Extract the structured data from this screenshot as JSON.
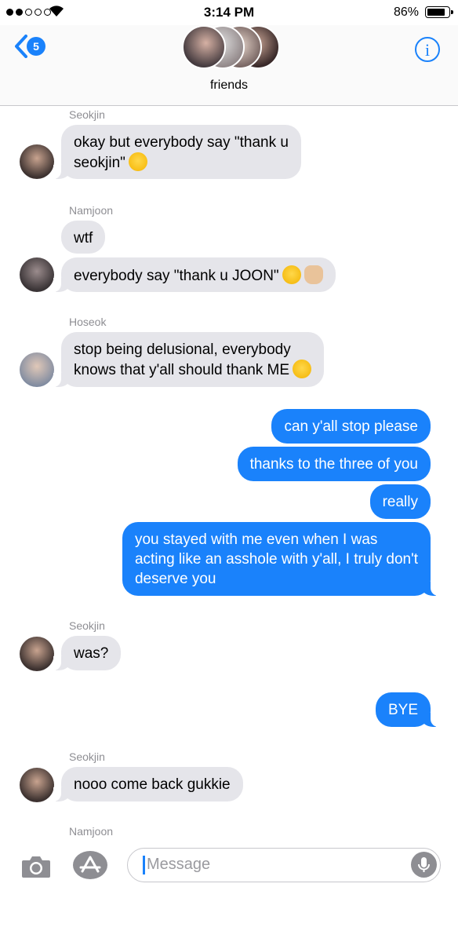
{
  "status_bar": {
    "time": "3:14 PM",
    "battery_percent": "86%",
    "signal_bars": 2,
    "battery_level": 0.86
  },
  "header": {
    "back_badge": "5",
    "group_name": "friends",
    "info_label": "i"
  },
  "chat": {
    "messages": [
      {
        "sender": "Seokjin",
        "lines": [
          "okay but everybody say \"thank u",
          "seokjin\""
        ],
        "emoji": "star-struck-emoji"
      },
      {
        "sender": "Namjoon",
        "lines": [
          "wtf"
        ]
      },
      {
        "sender": "Namjoon",
        "lines": [
          "everybody say \"thank u JOON\""
        ],
        "emoji": "neutral-face-emoji, raised-hand-emoji"
      },
      {
        "sender": "Hoseok",
        "lines": [
          "stop being delusional, everybody",
          "knows that y'all should thank ME"
        ],
        "emoji": "relieved-face-emoji"
      },
      {
        "sender": "me",
        "lines": [
          "can y'all stop please"
        ]
      },
      {
        "sender": "me",
        "lines": [
          "thanks to the three of you"
        ]
      },
      {
        "sender": "me",
        "lines": [
          "really"
        ]
      },
      {
        "sender": "me",
        "lines": [
          "you stayed with me even when I was",
          "acting like an asshole with y'all, I truly don't",
          "deserve you"
        ]
      },
      {
        "sender": "Seokjin",
        "lines": [
          "was?"
        ]
      },
      {
        "sender": "me",
        "lines": [
          "BYE"
        ]
      },
      {
        "sender": "Seokjin",
        "lines": [
          "nooo come back gukkie"
        ]
      },
      {
        "sender": "Namjoon",
        "lines": []
      }
    ]
  },
  "input": {
    "placeholder": "Message"
  },
  "icons": {
    "camera": "camera-icon",
    "appstore": "app-store-icon",
    "mic": "microphone-icon",
    "wifi": "wifi-icon",
    "back": "chevron-left-icon",
    "info": "info-icon"
  },
  "colors": {
    "accent": "#1a82fb",
    "incoming_bubble": "#e5e5ea",
    "sender_label": "#8e8e93"
  }
}
